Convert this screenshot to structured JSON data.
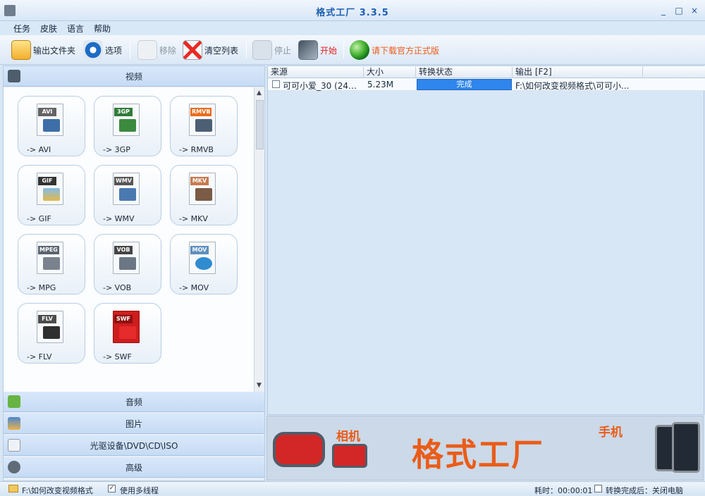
{
  "window": {
    "title": "格式工厂  3.3.5"
  },
  "menus": [
    "任务",
    "皮肤",
    "语言",
    "帮助"
  ],
  "toolbar": [
    {
      "label": "输出文件夹",
      "icon": "folder-icon",
      "enabled": true
    },
    {
      "label": "选项",
      "icon": "gear-icon",
      "enabled": true
    },
    {
      "label": "移除",
      "icon": "remove-icon",
      "enabled": false
    },
    {
      "label": "清空列表",
      "icon": "clear-list-icon",
      "enabled": true
    },
    {
      "label": "停止",
      "icon": "stop-icon",
      "enabled": false
    },
    {
      "label": "开始",
      "icon": "start-icon",
      "enabled": true
    },
    {
      "label": "请下载官方正式版",
      "icon": "globe-icon",
      "enabled": true
    }
  ],
  "categories": [
    "视频",
    "音频",
    "图片",
    "光驱设备\\DVD\\CD\\ISO",
    "高级"
  ],
  "formats": [
    {
      "label": "-> AVI",
      "tag": "AVI",
      "color": "#666666"
    },
    {
      "label": "-> 3GP",
      "tag": "3GP",
      "color": "#2f7b39"
    },
    {
      "label": "-> RMVB",
      "tag": "RMVB",
      "color": "#e86c1d"
    },
    {
      "label": "-> GIF",
      "tag": "GIF",
      "color": "#333333"
    },
    {
      "label": "-> WMV",
      "tag": "WMV",
      "color": "#555555"
    },
    {
      "label": "-> MKV",
      "tag": "MKV",
      "color": "#c77b50"
    },
    {
      "label": "-> MPG",
      "tag": "MPEG",
      "color": "#5a6470"
    },
    {
      "label": "-> VOB",
      "tag": "VOB",
      "color": "#444444"
    },
    {
      "label": "-> MOV",
      "tag": "MOV",
      "color": "#5d8fbd"
    },
    {
      "label": "-> FLV",
      "tag": "FLV",
      "color": "#4c4c4c"
    },
    {
      "label": "-> SWF",
      "tag": "SWF",
      "color": "#cf1d1d"
    }
  ],
  "table": {
    "columns": [
      "来源",
      "大小",
      "转换状态",
      "输出 [F2]"
    ],
    "rows": [
      {
        "source": "可可小爱_30 (240...",
        "size": "5.23M",
        "status": "完成",
        "output": "F:\\如何改变视频格式\\可可小..."
      }
    ]
  },
  "banner": {
    "camera_label": "相机",
    "brand": "格式工厂",
    "phone_label": "手机"
  },
  "status": {
    "folder": "F:\\如何改变视频格式",
    "multithread_label": "使用多线程",
    "multithread_checked": true,
    "elapsed": "耗时：00:00:01",
    "after_complete_label": "转换完成后：关闭电脑",
    "after_complete_checked": false
  }
}
